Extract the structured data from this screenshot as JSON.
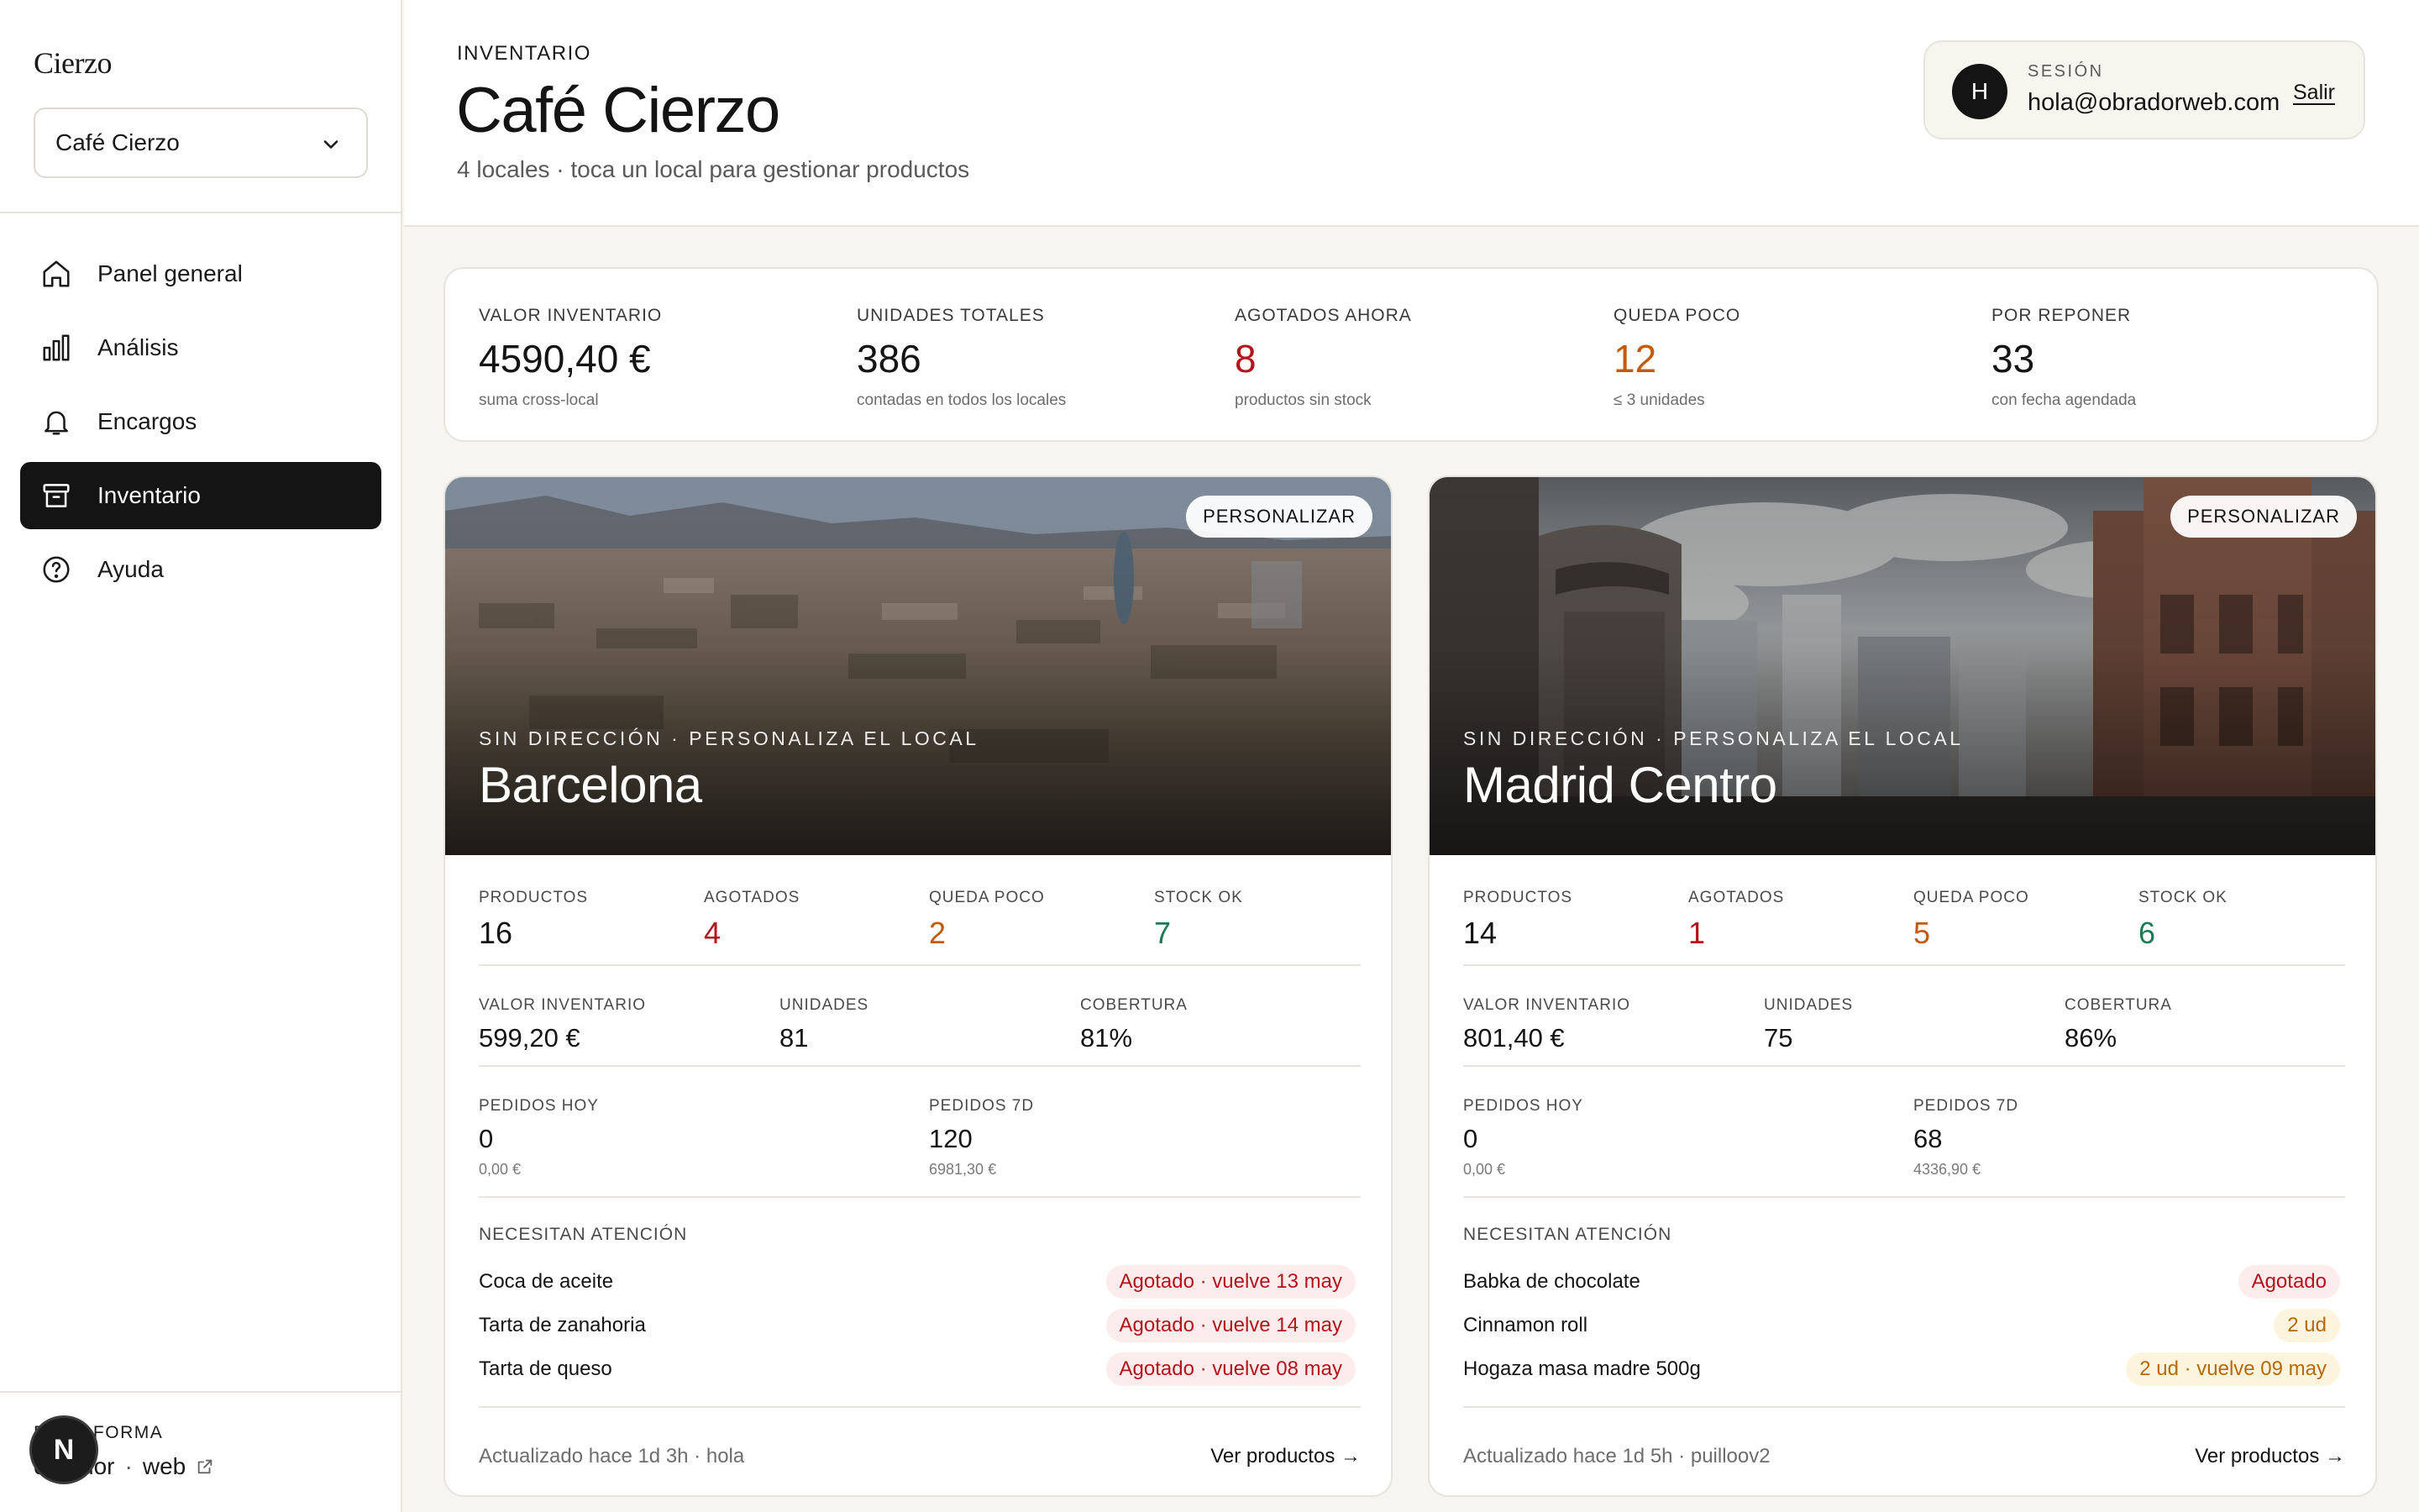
{
  "sidebar": {
    "brand": "Cierzo",
    "store_selected": "Café Cierzo",
    "nav": [
      {
        "label": "Panel general",
        "icon": "home-icon"
      },
      {
        "label": "Análisis",
        "icon": "bar-chart-icon"
      },
      {
        "label": "Encargos",
        "icon": "bell-icon"
      },
      {
        "label": "Inventario",
        "icon": "archive-box-icon",
        "active": true
      },
      {
        "label": "Ayuda",
        "icon": "help-circle-icon"
      }
    ],
    "platform_label": "PLATAFORMA",
    "platform_link": {
      "part1": "obrador",
      "sep": "·",
      "part2": "web"
    },
    "n_badge": "N"
  },
  "header": {
    "eyebrow": "INVENTARIO",
    "title": "Café Cierzo",
    "subtitle": "4 locales · toca un local para gestionar productos"
  },
  "session": {
    "avatar_initial": "H",
    "label": "SESIÓN",
    "email": "hola@obradorweb.com",
    "logout": "Salir"
  },
  "summary": [
    {
      "label": "VALOR INVENTARIO",
      "value": "4590,40 €",
      "note": "suma cross-local"
    },
    {
      "label": "UNIDADES TOTALES",
      "value": "386",
      "note": "contadas en todos los locales"
    },
    {
      "label": "AGOTADOS AHORA",
      "value": "8",
      "note": "productos sin stock"
    },
    {
      "label": "QUEDA POCO",
      "value": "12",
      "note": "≤ 3 unidades"
    },
    {
      "label": "POR REPONER",
      "value": "33",
      "note": "con fecha agendada"
    }
  ],
  "locations": [
    {
      "customize": "PERSONALIZAR",
      "eyebrow": "SIN DIRECCIÓN · PERSONALIZA EL LOCAL",
      "name": "Barcelona",
      "stats": {
        "productos_label": "PRODUCTOS",
        "productos": "16",
        "agotados_label": "AGOTADOS",
        "agotados": "4",
        "queda_poco_label": "QUEDA POCO",
        "queda_poco": "2",
        "stock_ok_label": "STOCK OK",
        "stock_ok": "7"
      },
      "inventory": {
        "valor_label": "VALOR INVENTARIO",
        "valor": "599,20 €",
        "unidades_label": "UNIDADES",
        "unidades": "81",
        "cobertura_label": "COBERTURA",
        "cobertura": "81%"
      },
      "orders": {
        "hoy_label": "PEDIDOS HOY",
        "hoy": "0",
        "hoy_amount": "0,00 €",
        "semana_label": "PEDIDOS 7D",
        "semana": "120",
        "semana_amount": "6981,30 €"
      },
      "attention_title": "NECESITAN ATENCIÓN",
      "attention": [
        {
          "name": "Coca de aceite",
          "status": "Agotado · vuelve 13 may",
          "tone": "red"
        },
        {
          "name": "Tarta de zanahoria",
          "status": "Agotado · vuelve 14 may",
          "tone": "red"
        },
        {
          "name": "Tarta de queso",
          "status": "Agotado · vuelve 08 may",
          "tone": "red"
        }
      ],
      "updated": "Actualizado hace 1d 3h · hola",
      "view_products": "Ver productos →"
    },
    {
      "customize": "PERSONALIZAR",
      "eyebrow": "SIN DIRECCIÓN · PERSONALIZA EL LOCAL",
      "name": "Madrid Centro",
      "stats": {
        "productos_label": "PRODUCTOS",
        "productos": "14",
        "agotados_label": "AGOTADOS",
        "agotados": "1",
        "queda_poco_label": "QUEDA POCO",
        "queda_poco": "5",
        "stock_ok_label": "STOCK OK",
        "stock_ok": "6"
      },
      "inventory": {
        "valor_label": "VALOR INVENTARIO",
        "valor": "801,40 €",
        "unidades_label": "UNIDADES",
        "unidades": "75",
        "cobertura_label": "COBERTURA",
        "cobertura": "86%"
      },
      "orders": {
        "hoy_label": "PEDIDOS HOY",
        "hoy": "0",
        "hoy_amount": "0,00 €",
        "semana_label": "PEDIDOS 7D",
        "semana": "68",
        "semana_amount": "4336,90 €"
      },
      "attention_title": "NECESITAN ATENCIÓN",
      "attention": [
        {
          "name": "Babka de chocolate",
          "status": "Agotado",
          "tone": "red"
        },
        {
          "name": "Cinnamon roll",
          "status": "2 ud",
          "tone": "amber"
        },
        {
          "name": "Hogaza masa madre 500g",
          "status": "2 ud · vuelve 09 may",
          "tone": "amber"
        }
      ],
      "updated": "Actualizado hace 1d 5h · puilloov2",
      "view_products": "Ver productos →"
    }
  ],
  "colors": {
    "danger": "#b3131b",
    "warning": "#c35a0d",
    "ok": "#1d7a52",
    "active_nav": "#141414"
  }
}
